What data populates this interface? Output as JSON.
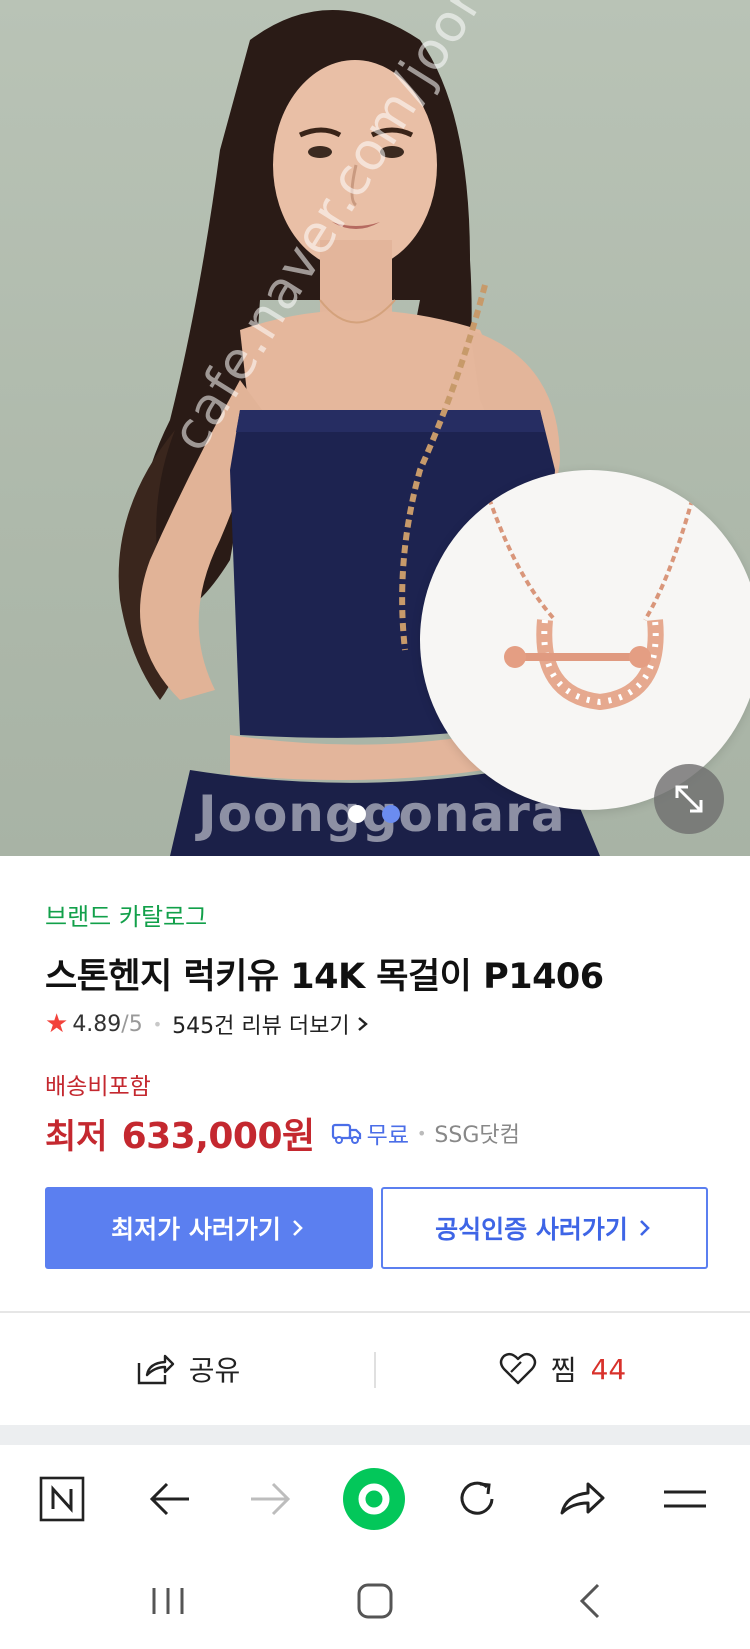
{
  "product": {
    "brand_link": "브랜드 카탈로그",
    "title": "스톤헨지 럭키유 14K 목걸이 P1406",
    "rating": "4.89",
    "rating_max": "/5",
    "reviews": "545건 리뷰 더보기",
    "shipping_note": "배송비포함",
    "price_label": "최저",
    "price": "633,000원",
    "delivery": "무료",
    "seller": "SSG닷컴"
  },
  "gallery": {
    "watermark_url": "cafe.naver.com/joonggonara",
    "watermark_logo": "Joonggonara",
    "page_count": 2,
    "active_index": 1
  },
  "buttons": {
    "lowest_price": "최저가 사러가기",
    "official": "공식인증 사러가기"
  },
  "actions": {
    "share": "공유",
    "like": "찜",
    "like_count": "44"
  },
  "colors": {
    "brand_green": "#12a04a",
    "price_red": "#c4282f",
    "primary_blue": "#5b7ff0",
    "naver_green": "#03c75a"
  }
}
